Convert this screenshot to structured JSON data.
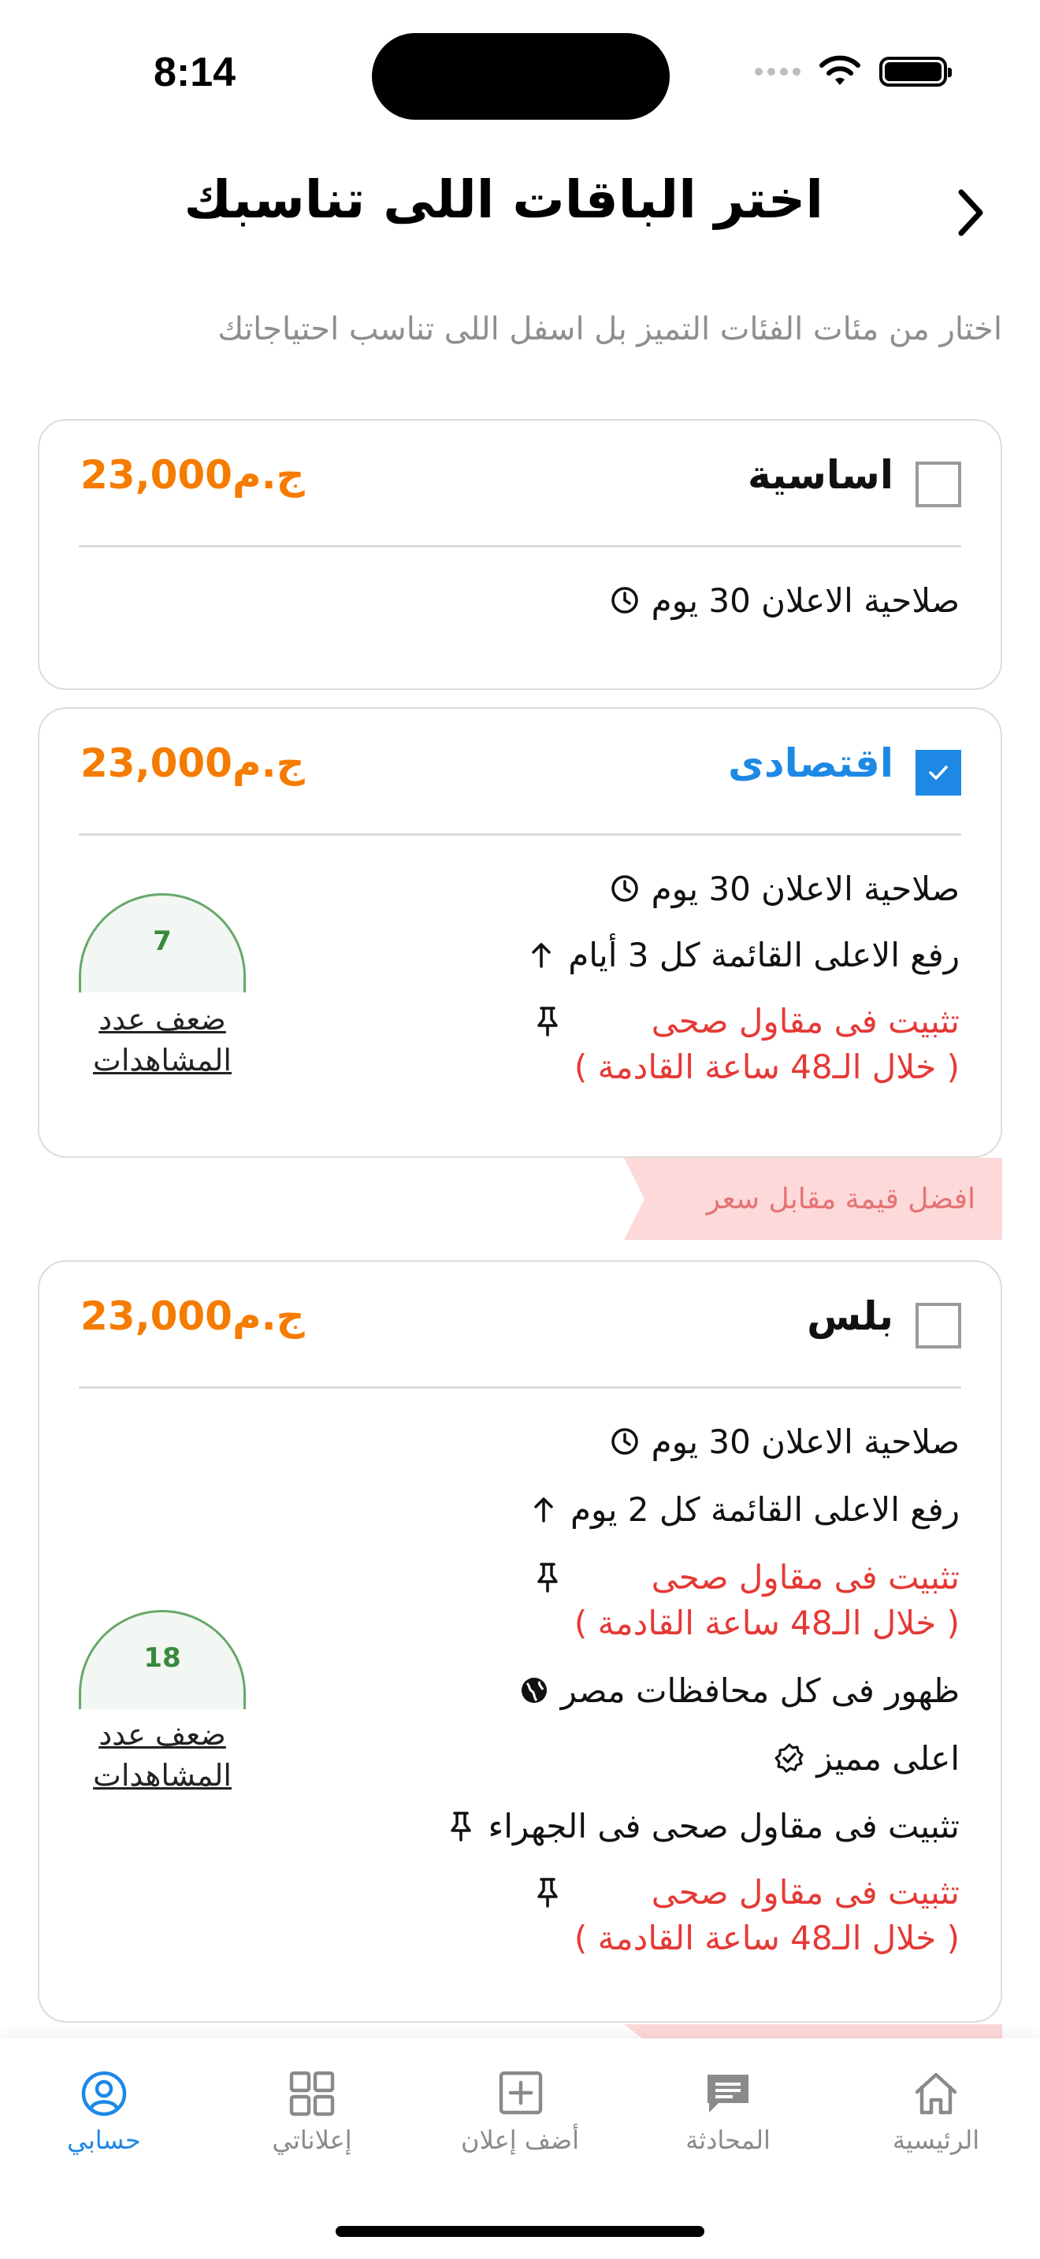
{
  "status_bar": {
    "time": "8:14"
  },
  "header": {
    "title": "اختر الباقات اللى تناسبك",
    "subtitle": "اختار من مئات الفئات التميز بل اسفل اللى تناسب احتياجاتك"
  },
  "packages": [
    {
      "name": "اساسية",
      "price": "23,000ج.م",
      "checked": false,
      "features": [
        {
          "icon": "clock-icon",
          "text": "صلاحية الاعلان 30 يوم"
        }
      ]
    },
    {
      "name": "اقتصادى",
      "price": "23,000ج.م",
      "checked": true,
      "features": [
        {
          "icon": "clock-icon",
          "text": "صلاحية الاعلان 30 يوم"
        },
        {
          "icon": "arrow-up-icon",
          "text": "رفع الاعلى القائمة كل 3 أيام"
        },
        {
          "icon": "pin-icon",
          "text": "تثبيت فى مقاول صحى",
          "sub": "( خلال الـ48 ساعة القادمة )"
        }
      ],
      "views_multiplier": "7",
      "views_label_1": "ضعف عدد",
      "views_label_2": "المشاهدات"
    },
    {
      "name": "بلس",
      "price": "23,000ج.م",
      "checked": false,
      "features": [
        {
          "icon": "clock-icon",
          "text": "صلاحية الاعلان 30 يوم"
        },
        {
          "icon": "arrow-up-icon",
          "text": "رفع الاعلى القائمة كل 2 يوم"
        },
        {
          "icon": "pin-icon",
          "text": "تثبيت فى مقاول صحى",
          "sub": "( خلال الـ48 ساعة القادمة )"
        },
        {
          "icon": "globe-icon",
          "text": "ظهور فى كل محافظات مصر"
        },
        {
          "icon": "verified-badge-icon",
          "text": "اعلى مميز"
        },
        {
          "icon": "pin-icon",
          "text": "تثبيت فى مقاول صحى فى الجهراء"
        },
        {
          "icon": "pin-icon",
          "text": "تثبيت فى مقاول صحى",
          "sub": "( خلال الـ48 ساعة القادمة )"
        }
      ],
      "views_multiplier": "18",
      "views_label_1": "ضعف عدد",
      "views_label_2": "المشاهدات"
    }
  ],
  "ribbon": {
    "label": "افضل قيمة مقابل سعر"
  },
  "bottom_nav": [
    {
      "icon": "home-icon",
      "label": "الرئيسية"
    },
    {
      "icon": "chat-icon",
      "label": "المحادثة"
    },
    {
      "icon": "add-square-icon",
      "label": "أضف إعلان"
    },
    {
      "icon": "grid-icon",
      "label": "إعلاناتي"
    },
    {
      "icon": "user-circle-icon",
      "label": "حسابي",
      "active": true
    }
  ],
  "colors": {
    "accent": "#1e88e5",
    "price": "#f57c00",
    "highlight_red": "#e53935",
    "ribbon_bg": "#fdd9d9",
    "views_green": "#3a8a3e"
  }
}
